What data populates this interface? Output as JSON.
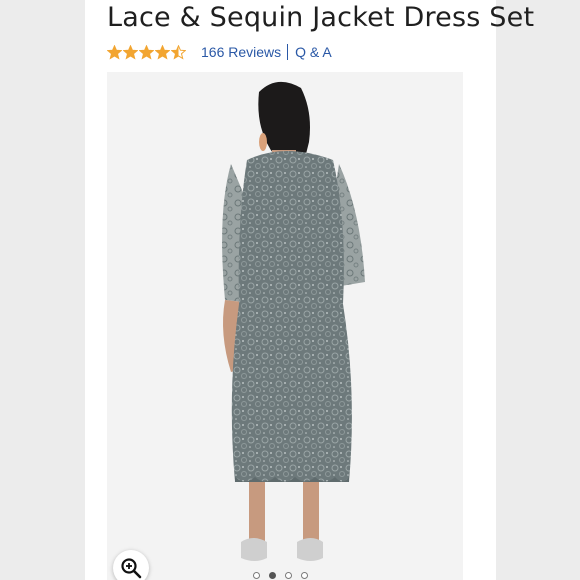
{
  "product": {
    "title": "Lace & Sequin Jacket Dress Set",
    "rating_value": 4.5,
    "reviews_label": "166 Reviews",
    "qa_label": "Q & A"
  },
  "gallery": {
    "image_count": 4,
    "active_index": 1
  },
  "colors": {
    "star": "#f2a531",
    "link": "#2a58a6",
    "dress": "#6e7a7c",
    "background": "#ececec"
  },
  "icons": {
    "star": "star-icon",
    "zoom": "zoom-in-icon"
  }
}
